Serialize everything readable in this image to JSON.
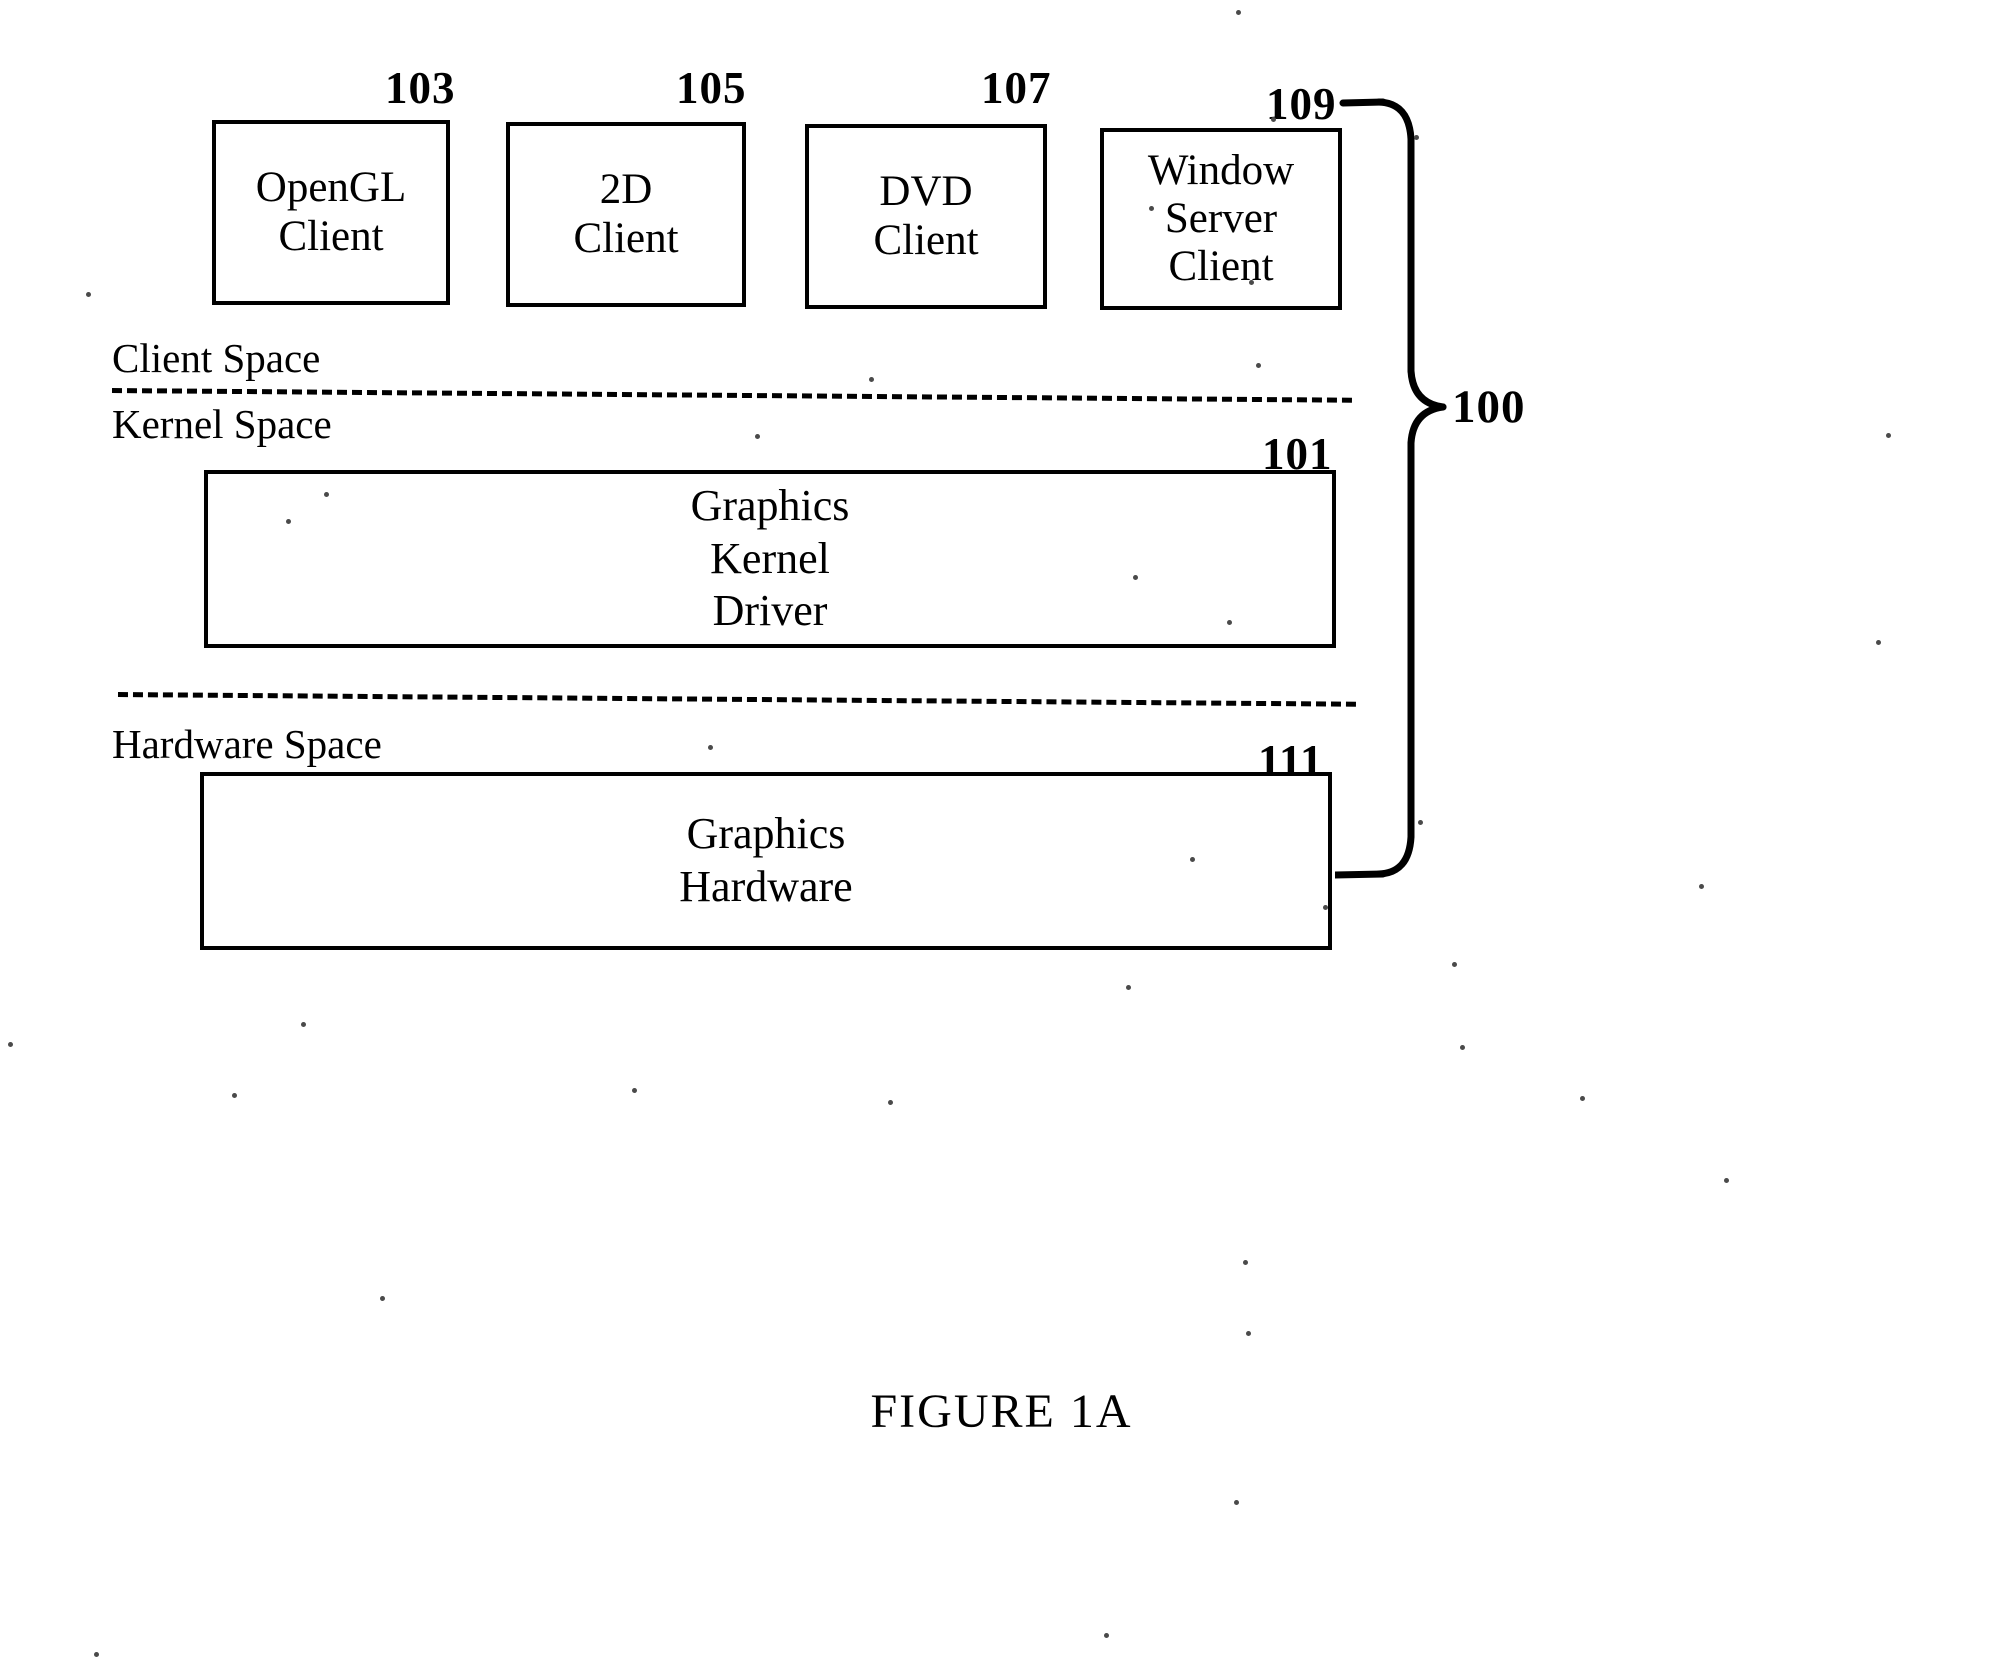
{
  "figure": {
    "caption": "FIGURE 1A",
    "system_ref": "100"
  },
  "client_space": {
    "label": "Client Space",
    "boxes": [
      {
        "ref": "103",
        "line1": "OpenGL",
        "line2": "Client"
      },
      {
        "ref": "105",
        "line1": "2D",
        "line2": "Client"
      },
      {
        "ref": "107",
        "line1": "DVD",
        "line2": "Client"
      },
      {
        "ref": "109",
        "line1": "Window",
        "line2": "Server",
        "line3": "Client"
      }
    ]
  },
  "kernel_space": {
    "label": "Kernel Space",
    "driver": {
      "ref": "101",
      "line1": "Graphics",
      "line2": "Kernel",
      "line3": "Driver"
    }
  },
  "hardware_space": {
    "label": "Hardware Space",
    "hardware": {
      "ref": "111",
      "line1": "Graphics",
      "line2": "Hardware"
    }
  },
  "style": {
    "ink": "#000000",
    "paper": "#ffffff"
  }
}
